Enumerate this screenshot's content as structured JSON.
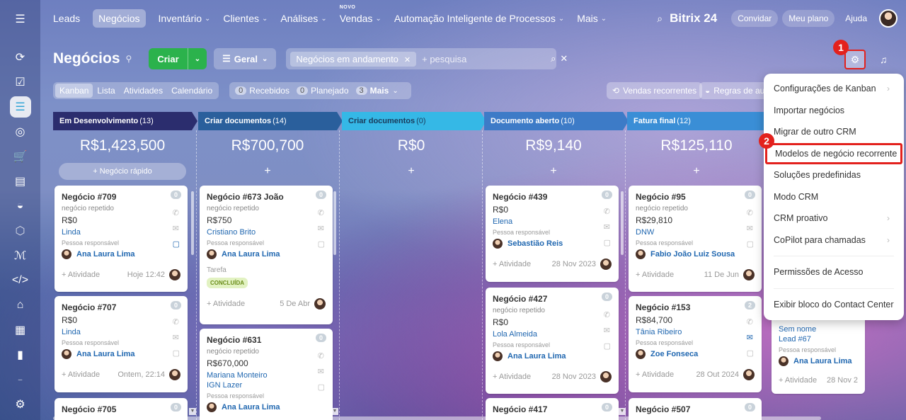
{
  "nav": {
    "items": [
      {
        "label": "Leads",
        "chev": false,
        "active": false
      },
      {
        "label": "Negócios",
        "chev": false,
        "active": true
      },
      {
        "label": "Inventário",
        "chev": true,
        "active": false
      },
      {
        "label": "Clientes",
        "chev": true,
        "active": false
      },
      {
        "label": "Análises",
        "chev": true,
        "active": false
      },
      {
        "label": "Vendas",
        "chev": true,
        "active": false,
        "badge": "NOVO"
      },
      {
        "label": "Automação Inteligente de Processos",
        "chev": true,
        "active": false
      },
      {
        "label": "Mais",
        "chev": true,
        "active": false
      }
    ],
    "brand": "Bitrix 24",
    "invite": "Convidar",
    "plan": "Meu plano",
    "help": "Ajuda"
  },
  "header": {
    "title": "Negócios",
    "create": "Criar",
    "general": "Geral",
    "filter_tag": "Negócios em andamento",
    "search_placeholder": "+ pesquisa"
  },
  "views": {
    "items": [
      "Kanban",
      "Lista",
      "Atividades",
      "Calendário"
    ],
    "counters": [
      {
        "n": "0",
        "label": "Recebidos"
      },
      {
        "n": "0",
        "label": "Planejado"
      },
      {
        "n": "3",
        "label": "Mais"
      }
    ],
    "recurring": "Vendas recorrentes",
    "rules": "Regras de automação"
  },
  "steps": {
    "one": "1",
    "two": "2"
  },
  "columns": [
    {
      "name": "Em Desenvolvimento",
      "count": "(13)",
      "total": "R$1,423,500",
      "add": "+ Negócio rápido",
      "color": "#2b2d6e"
    },
    {
      "name": "Criar documentos",
      "count": "(14)",
      "total": "R$700,700",
      "add": "+",
      "color": "#2a5f9c"
    },
    {
      "name": "Criar documentos",
      "count": "(0)",
      "total": "R$0",
      "add": "+",
      "color": "#35b8e6"
    },
    {
      "name": "Documento aberto",
      "count": "(10)",
      "total": "R$9,140",
      "add": "+",
      "color": "#3d7bc7"
    },
    {
      "name": "Fatura final",
      "count": "(12)",
      "total": "R$125,110",
      "add": "+",
      "color": "#3a8ed6"
    }
  ],
  "cards": {
    "c709": {
      "title": "Negócio #709",
      "badge": "0",
      "sub": "negócio repetido",
      "price": "R$0",
      "link": "Linda",
      "resp": "Pessoa responsável",
      "person": "Ana Laura Lima",
      "activity": "+ Atividade",
      "date": "Hoje 12:42"
    },
    "c707": {
      "title": "Negócio #707",
      "badge": "0",
      "price": "R$0",
      "link": "Linda",
      "resp": "Pessoa responsável",
      "person": "Ana Laura Lima",
      "activity": "+ Atividade",
      "date": "Ontem, 22:14"
    },
    "c705": {
      "title": "Negócio #705",
      "badge": "0"
    },
    "c673": {
      "title": "Negócio #673 João",
      "badge": "0",
      "sub": "negócio repetido",
      "price": "R$750",
      "link": "Cristiano Brito",
      "resp": "Pessoa responsável",
      "person": "Ana Laura Lima",
      "task": "Tarefa",
      "done": "CONCLUÍDA",
      "activity": "+ Atividade",
      "date": "5 De Abr"
    },
    "c631": {
      "title": "Negócio #631",
      "badge": "0",
      "sub": "negócio repetido",
      "price": "R$670,000",
      "link": "Mariana Monteiro",
      "link2": "IGN Lazer",
      "resp": "Pessoa responsável",
      "person": "Ana Laura Lima"
    },
    "c439": {
      "title": "Negócio #439",
      "badge": "0",
      "price": "R$0",
      "link": "Elena",
      "resp": "Pessoa responsável",
      "person": "Sebastião Reis",
      "activity": "+ Atividade",
      "date": "28 Nov 2023"
    },
    "c427": {
      "title": "Negócio #427",
      "badge": "0",
      "sub": "negócio repetido",
      "price": "R$0",
      "link": "Lola Almeida",
      "resp": "Pessoa responsável",
      "person": "Ana Laura Lima",
      "activity": "+ Atividade",
      "date": "28 Nov 2023"
    },
    "c417": {
      "title": "Negócio #417",
      "badge": "0"
    },
    "c95": {
      "title": "Negócio #95",
      "badge": "0",
      "sub": "negócio repetido",
      "price": "R$29,810",
      "link": "DNW",
      "resp": "Pessoa responsável",
      "person": "Fabio João Luiz Sousa",
      "activity": "+ Atividade",
      "date": "11 De Jun"
    },
    "c153": {
      "title": "Negócio #153",
      "badge": "2",
      "price": "R$84,700",
      "link": "Tânia Ribeiro",
      "resp": "Pessoa responsável",
      "person": "Zoe Fonseca",
      "activity": "+ Atividade",
      "date": "28 Out 2024"
    },
    "c507": {
      "title": "Negócio #507",
      "badge": "0"
    },
    "lead67": {
      "name": "Sem nome",
      "lead": "Lead #67",
      "resp": "Pessoa responsável",
      "person": "Ana Laura Lima",
      "activity": "+ Atividade",
      "date": "28 Nov 2"
    }
  },
  "menu": {
    "items": [
      {
        "label": "Configurações de Kanban",
        "arrow": true
      },
      {
        "label": "Importar negócios",
        "arrow": false
      },
      {
        "label": "Migrar de outro CRM",
        "arrow": false
      },
      {
        "label": "Modelos de negócio recorrente",
        "arrow": false,
        "highlight": true
      },
      {
        "label": "Soluções predefinidas",
        "arrow": false
      },
      {
        "label": "Modo CRM",
        "arrow": false
      },
      {
        "label": "CRM proativo",
        "arrow": true
      },
      {
        "label": "CoPilot para chamadas",
        "arrow": true
      }
    ],
    "bottom": [
      "Permissões de Acesso",
      "Exibir bloco do Contact Center"
    ]
  }
}
